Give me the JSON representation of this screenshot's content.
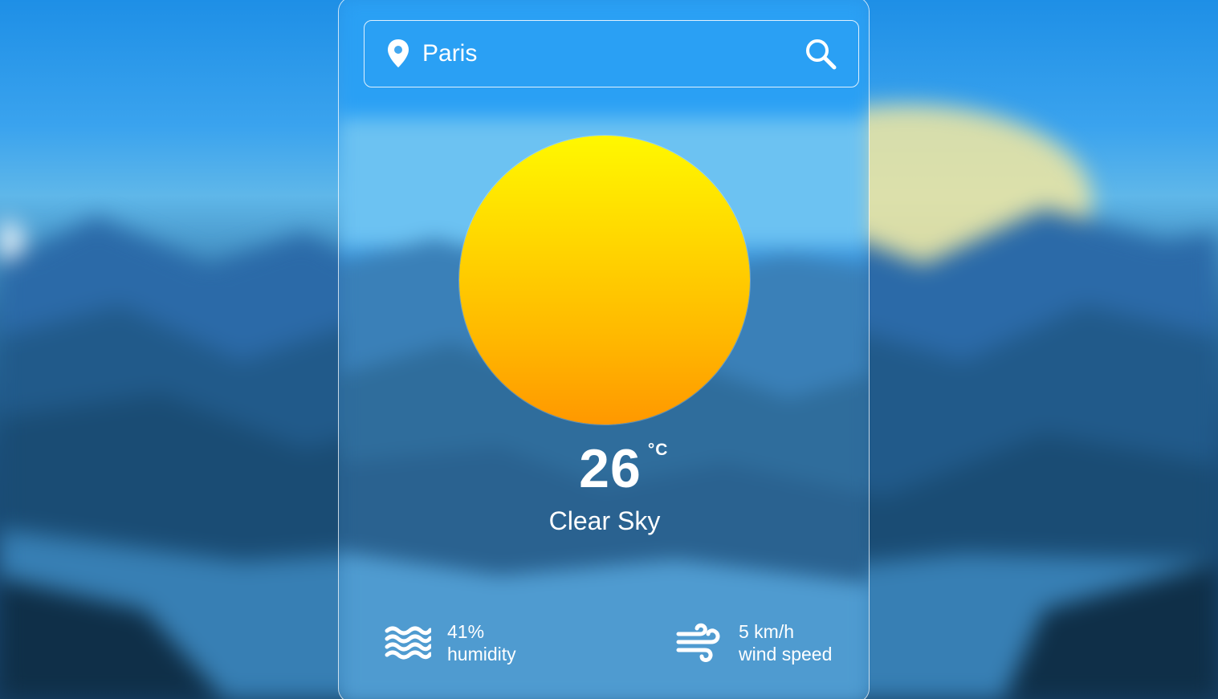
{
  "search": {
    "value": "Paris",
    "location_icon": "map-pin-icon",
    "search_icon": "search-icon"
  },
  "weather": {
    "icon": "sun-icon",
    "temperature": "26",
    "unit": "°C",
    "description": "Clear Sky"
  },
  "details": {
    "humidity": {
      "icon": "humidity-waves-icon",
      "value": "41%",
      "label": "humidity"
    },
    "wind": {
      "icon": "wind-icon",
      "value": "5 km/h",
      "label": "wind speed"
    }
  },
  "colors": {
    "sky": "#1e8fe6",
    "sun_top": "#fff800",
    "sun_bottom": "#ff9800",
    "text": "#ffffff"
  }
}
